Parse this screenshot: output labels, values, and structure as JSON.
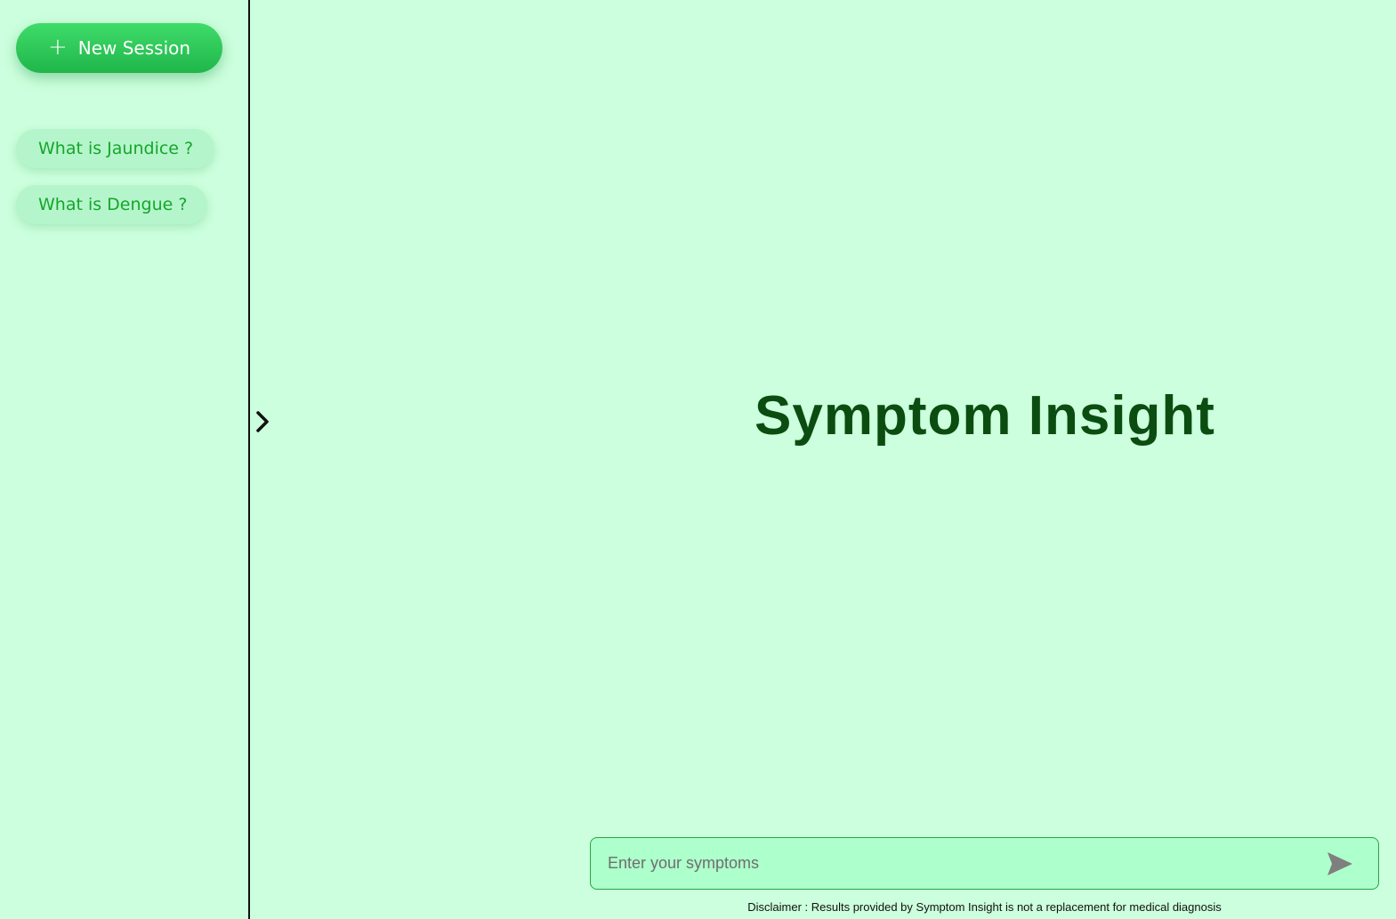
{
  "sidebar": {
    "new_session_label": "New Session",
    "history": [
      {
        "label": "What is Jaundice ?"
      },
      {
        "label": "What is Dengue ?"
      }
    ]
  },
  "main": {
    "title": "Symptom Insight"
  },
  "input": {
    "placeholder": "Enter your symptoms",
    "value": ""
  },
  "disclaimer": "Disclaimer : Results provided by Symptom Insight is not a replacement for medical diagnosis",
  "icons": {
    "new_session": "plus-icon",
    "toggle": "chevron-right-icon",
    "send": "send-icon"
  },
  "colors": {
    "background": "#ccffdd",
    "accent": "#20b64a",
    "title": "#0b4d10",
    "history_text": "#16a62a",
    "input_background": "#adffcb"
  }
}
